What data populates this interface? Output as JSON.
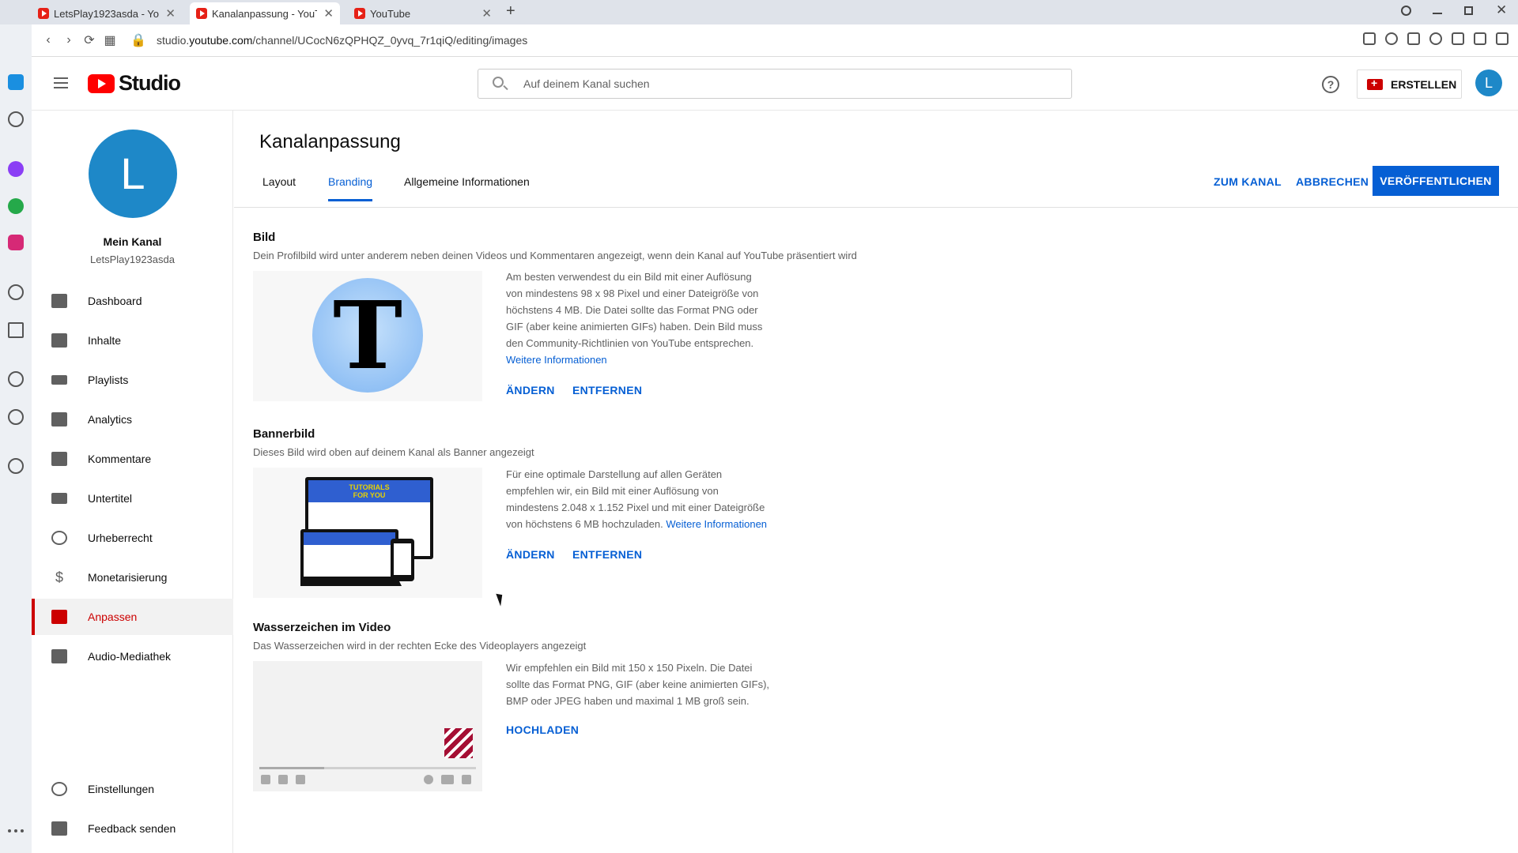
{
  "browser": {
    "tabs": [
      {
        "label": "LetsPlay1923asda - YouTube",
        "active": false
      },
      {
        "label": "Kanalanpassung - YouTube",
        "active": true
      },
      {
        "label": "YouTube",
        "active": false
      }
    ],
    "url_prefix": "studio.",
    "url_domain": "youtube.com",
    "url_path": "/channel/UCocN6zQPHQZ_0yvq_7r1qiQ/editing/images",
    "new_tab_label": "+"
  },
  "header": {
    "logo_text": "Studio",
    "search_placeholder": "Auf deinem Kanal suchen",
    "help_label": "?",
    "create_label": "ERSTELLEN",
    "avatar_letter": "L"
  },
  "channel": {
    "avatar_letter": "L",
    "title": "Mein Kanal",
    "handle": "LetsPlay1923asda"
  },
  "nav": {
    "items": [
      {
        "label": "Dashboard",
        "icon": "dashboard-icon",
        "active": false
      },
      {
        "label": "Inhalte",
        "icon": "content-icon",
        "active": false
      },
      {
        "label": "Playlists",
        "icon": "playlists-icon",
        "active": false
      },
      {
        "label": "Analytics",
        "icon": "analytics-icon",
        "active": false
      },
      {
        "label": "Kommentare",
        "icon": "comments-icon",
        "active": false
      },
      {
        "label": "Untertitel",
        "icon": "subtitles-icon",
        "active": false
      },
      {
        "label": "Urheberrecht",
        "icon": "copyright-icon",
        "active": false
      },
      {
        "label": "Monetarisierung",
        "icon": "dollar-icon",
        "active": false
      },
      {
        "label": "Anpassen",
        "icon": "magic-wand-icon",
        "active": true
      },
      {
        "label": "Audio-Mediathek",
        "icon": "audio-library-icon",
        "active": false
      }
    ],
    "settings_label": "Einstellungen",
    "feedback_label": "Feedback senden"
  },
  "main": {
    "title": "Kanalanpassung",
    "tabs": [
      {
        "label": "Layout",
        "active": false
      },
      {
        "label": "Branding",
        "active": true
      },
      {
        "label": "Allgemeine Informationen",
        "active": false
      }
    ],
    "to_channel_label": "ZUM KANAL",
    "cancel_label": "ABBRECHEN",
    "publish_label": "VERÖFFENTLICHEN",
    "picture": {
      "title": "Bild",
      "desc": "Dein Profilbild wird unter anderem neben deinen Videos und Kommentaren angezeigt, wenn dein Kanal auf YouTube präsentiert wird",
      "preview_letter": "T",
      "text": "Am besten verwendest du ein Bild mit einer Auflösung von mindestens 98 x 98 Pixel und einer Dateigröße von höchstens 4 MB. Die Datei sollte das Format PNG oder GIF (aber keine animierten GIFs) haben. Dein Bild muss den Community-Richtlinien von YouTube entsprechen.",
      "more_label": "Weitere Informationen",
      "change_label": "ÄNDERN",
      "remove_label": "ENTFERNEN"
    },
    "banner": {
      "title": "Bannerbild",
      "desc": "Dieses Bild wird oben auf deinem Kanal als Banner angezeigt",
      "banner_text": "TUTORIALS FOR YOU",
      "text": "Für eine optimale Darstellung auf allen Geräten empfehlen wir, ein Bild mit einer Auflösung von mindestens 2.048 x 1.152 Pixel und mit einer Dateigröße von höchstens 6 MB hochzuladen.",
      "more_label": "Weitere Informationen",
      "change_label": "ÄNDERN",
      "remove_label": "ENTFERNEN"
    },
    "watermark": {
      "title": "Wasserzeichen im Video",
      "desc": "Das Wasserzeichen wird in der rechten Ecke des Videoplayers angezeigt",
      "text": "Wir empfehlen ein Bild mit 150 x 150 Pixeln. Die Datei sollte das Format PNG, GIF (aber keine animierten GIFs), BMP oder JPEG haben und maximal 1 MB groß sein.",
      "upload_label": "HOCHLADEN"
    }
  }
}
